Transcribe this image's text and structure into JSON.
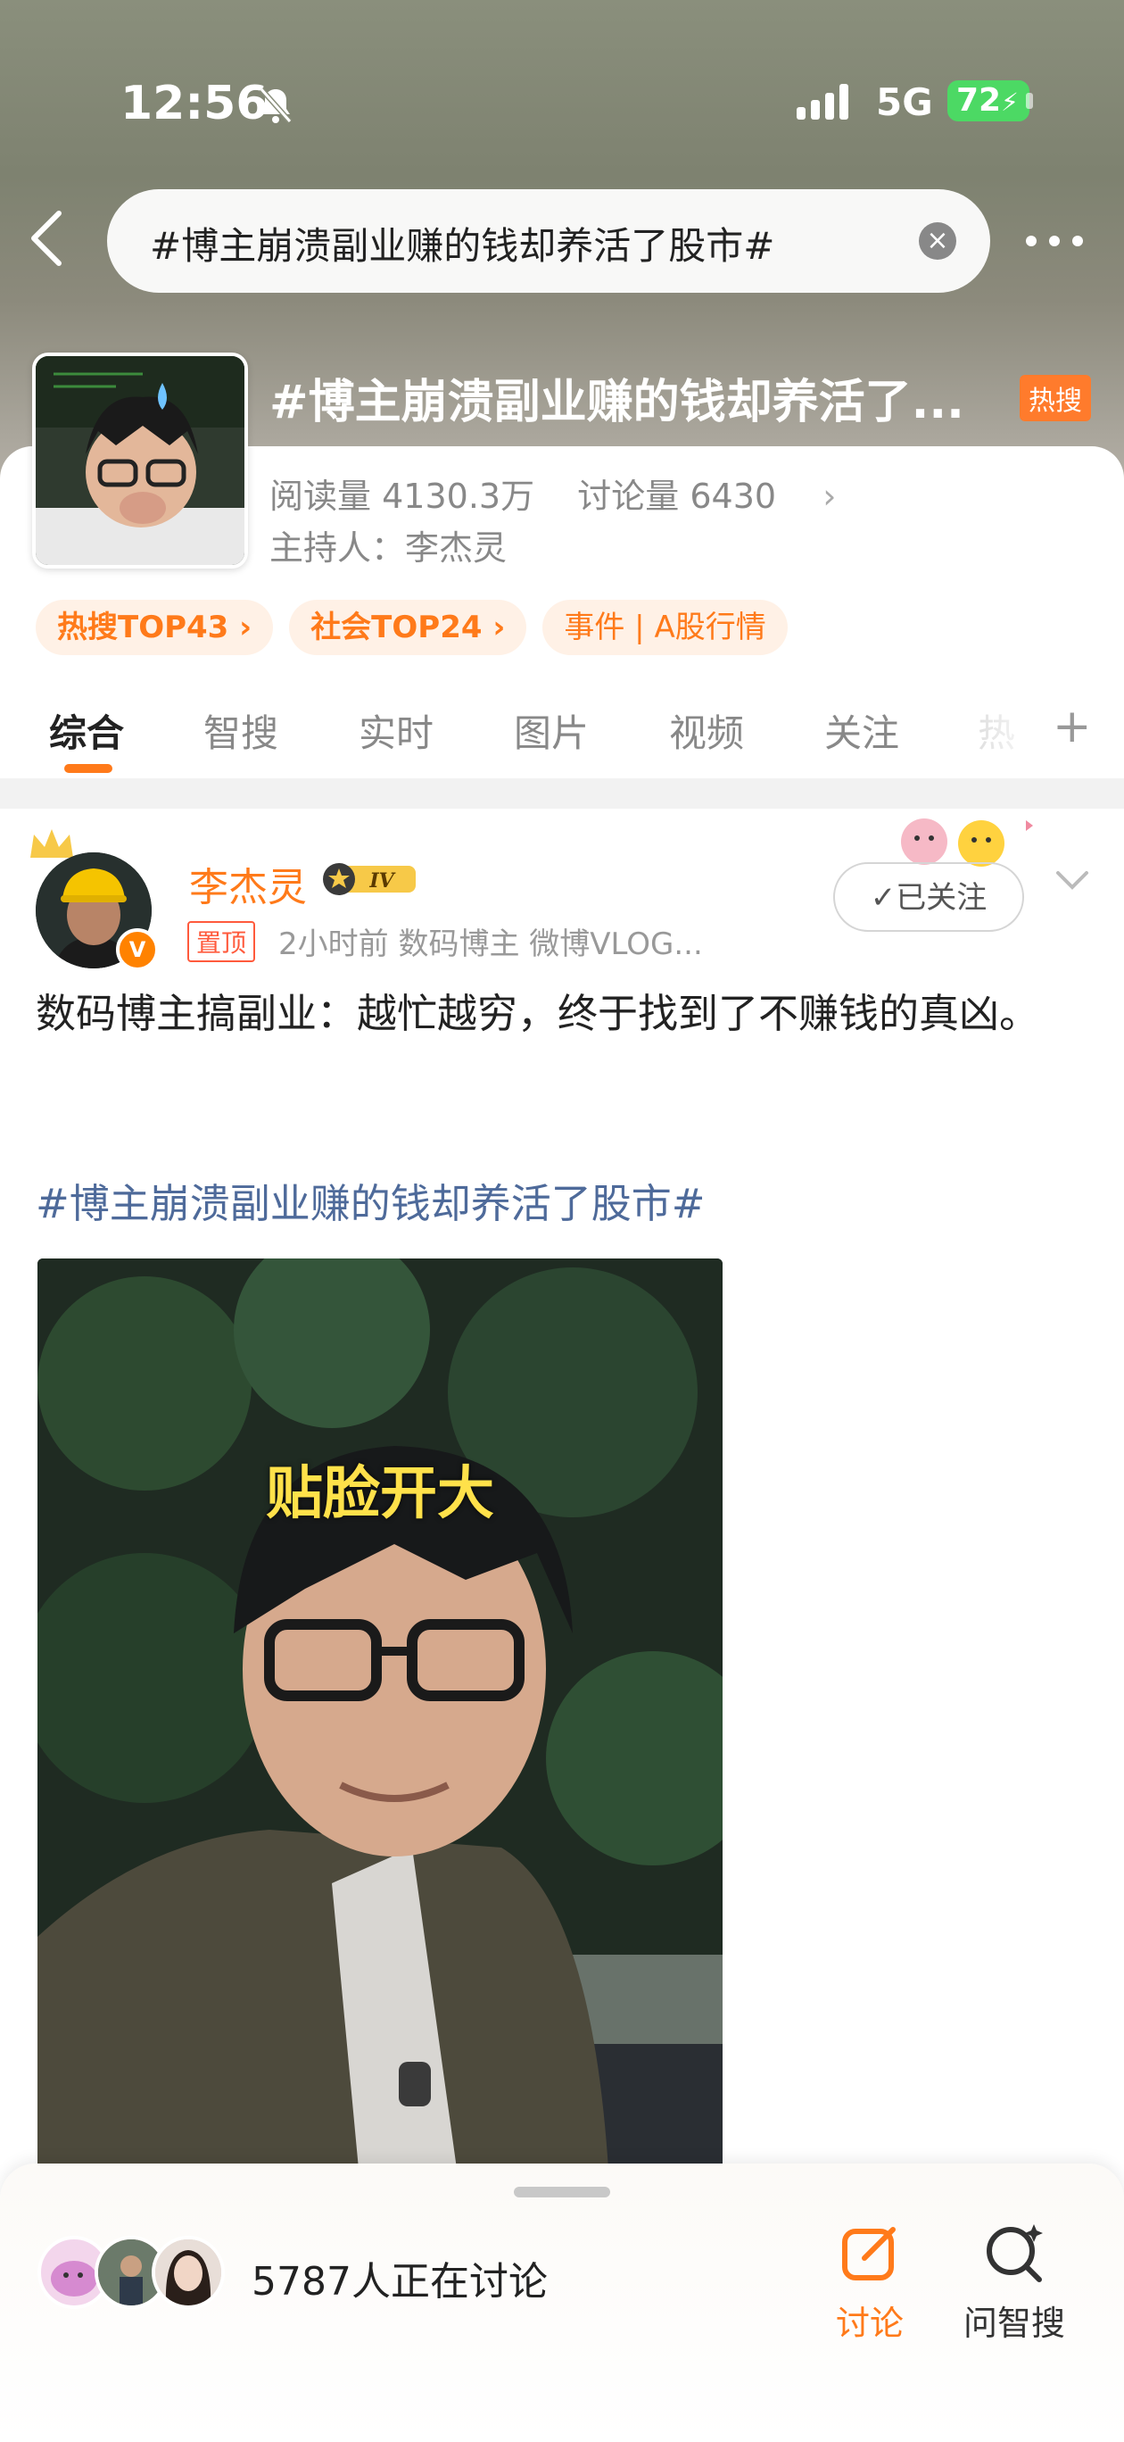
{
  "status_bar": {
    "time": "12:56",
    "network": "5G",
    "battery": "72"
  },
  "search": {
    "query": "#博主崩溃副业赚的钱却养活了股市#"
  },
  "topic": {
    "title": "#博主崩溃副业赚的钱却养活了...",
    "badge": "热搜",
    "reads_label": "阅读量",
    "reads_value": "4130.3万",
    "discuss_label": "讨论量",
    "discuss_value": "6430",
    "host_label": "主持人：",
    "host_name": "李杰灵"
  },
  "tags": [
    "热搜TOP43 ›",
    "社会TOP24 ›",
    "事件 | A股行情"
  ],
  "tabs": [
    "综合",
    "智搜",
    "实时",
    "图片",
    "视频",
    "关注"
  ],
  "tab_overflow": "热",
  "post": {
    "author": "李杰灵",
    "level": "IV",
    "pinned": "置顶",
    "meta": "2小时前  数码博主 微博VLOG...",
    "follow_label": "✓已关注",
    "text": "数码博主搞副业：越忙越穷，终于找到了不赚钱的真凶。",
    "hashtag": "#博主崩溃副业赚的钱却养活了股市#",
    "video_caption": "贴脸开大"
  },
  "bottom_bar": {
    "discussing": "5787人正在讨论",
    "discuss_button": "讨论",
    "ask_button": "问智搜"
  },
  "colors": {
    "accent": "#ff7a1a",
    "link": "#4e6a9a",
    "badge": "#ff7b2c"
  }
}
